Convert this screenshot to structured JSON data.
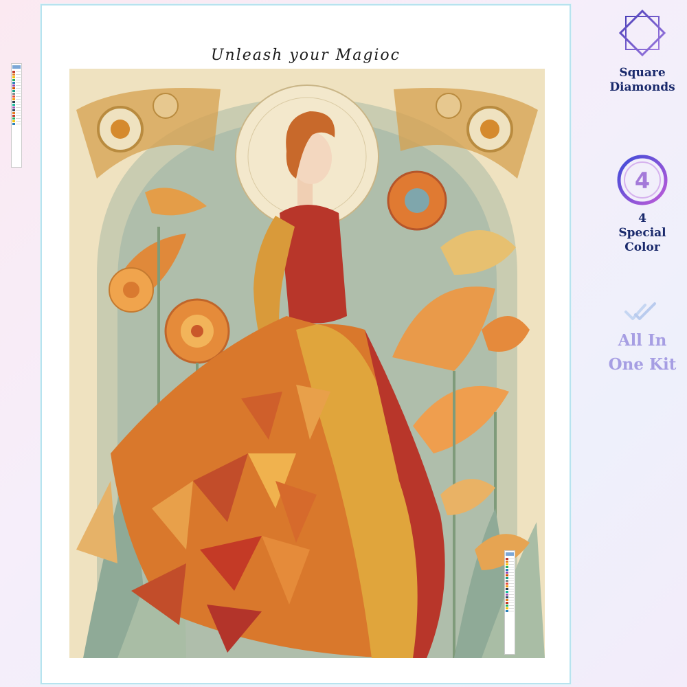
{
  "page": {
    "brand_line": "Unleash your Magioc"
  },
  "features": {
    "square": {
      "label_line1": "Square",
      "label_line2": "Diamonds",
      "icon": "diamond-square-icon"
    },
    "color": {
      "badge_number": "4",
      "label_line1": "4",
      "label_line2": "Special",
      "label_line3": "Color",
      "icon": "number-four-badge-icon"
    },
    "kit": {
      "label_line1": "All In",
      "label_line2": "One Kit",
      "icon": "double-check-icon"
    }
  },
  "colors": {
    "accent_navy": "#1a2a6c",
    "kit_lavender": "#a69ee3",
    "frame_border": "#b7e3ef",
    "art_background": "#efe2c0",
    "dress_orange": "#d9782c",
    "dress_red": "#b8362a",
    "hair_copper": "#c86a2a"
  },
  "artwork": {
    "subject": "woman-in-patchwork-dress-painting"
  }
}
